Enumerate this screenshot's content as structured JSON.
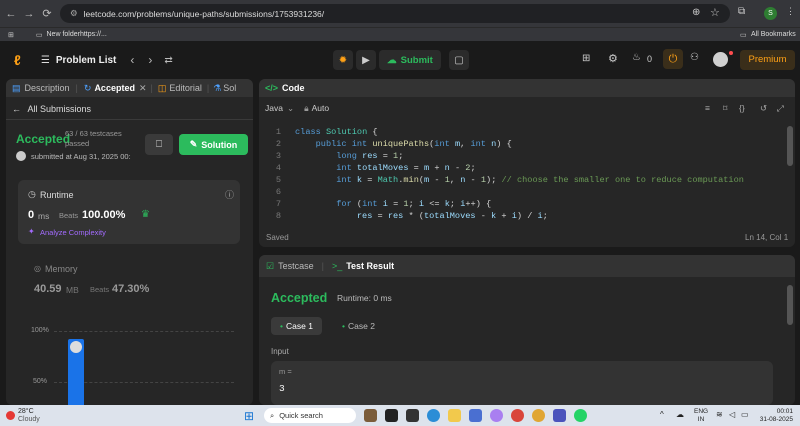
{
  "browser": {
    "url": "leetcode.com/problems/unique-paths/submissions/1753931236/",
    "avatar_letter": "S"
  },
  "bookmarks": {
    "folder": "New folderhttps://...",
    "all": "All Bookmarks"
  },
  "top": {
    "problem_list": "Problem List",
    "submit": "Submit",
    "premium": "Premium",
    "streak_count": "0"
  },
  "tabs": {
    "description": "Description",
    "accepted": "Accepted",
    "editorial": "Editorial",
    "solutions": "Sol"
  },
  "submissions": {
    "back": "All Submissions",
    "status": "Accepted",
    "testcases": "63 / 63 testcases passed",
    "submitted": "submitted at Aug 31, 2025 00:",
    "solution_btn": "Solution"
  },
  "runtime": {
    "label": "Runtime",
    "value": "0",
    "unit": "ms",
    "beats_label": "Beats",
    "beats": "100.00%",
    "analyze": "Analyze Complexity"
  },
  "memory": {
    "label": "Memory",
    "value": "40.59",
    "unit": "MB",
    "beats_label": "Beats",
    "beats": "47.30%"
  },
  "dist": {
    "y100": "100%",
    "y50": "50%"
  },
  "code": {
    "title": "Code",
    "language": "Java",
    "auto": "Auto",
    "saved": "Saved",
    "pos": "Ln 14, Col 1"
  },
  "result": {
    "testcase_tab": "Testcase",
    "result_tab": "Test Result",
    "status": "Accepted",
    "runtime": "Runtime: 0 ms",
    "case1": "Case 1",
    "case2": "Case 2",
    "input_label": "Input",
    "var": "m =",
    "val": "3"
  },
  "taskbar": {
    "temp": "28°C",
    "weather": "Cloudy",
    "search": "Quick search",
    "lang1": "ENG",
    "lang2": "IN",
    "time": "00:01",
    "date": "31-08-2025"
  },
  "colors": {
    "accent": "#2cbb5d",
    "premium": "#ffa116",
    "bg": "#1a1a1a"
  }
}
